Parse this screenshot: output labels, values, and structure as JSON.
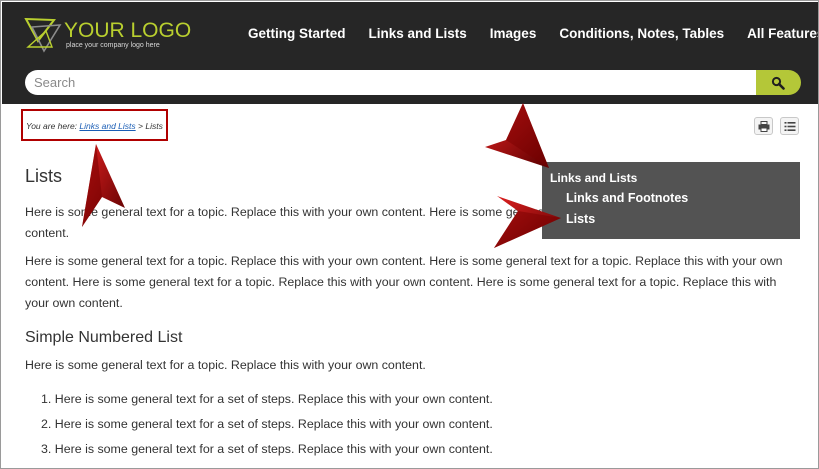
{
  "logo": {
    "text": "YOUR LOGO",
    "tagline": "place your company logo here"
  },
  "topnav": {
    "items": [
      "Getting Started",
      "Links and Lists",
      "Images",
      "Conditions, Notes, Tables",
      "All Features"
    ]
  },
  "search": {
    "placeholder": "Search"
  },
  "breadcrumb": {
    "prefix": "You are here:",
    "link": "Links and Lists",
    "separator": ">",
    "current": "Lists"
  },
  "toolbar": {
    "print_icon": "printer-icon",
    "toc_icon": "list-icon"
  },
  "sidemenu": {
    "parent": "Links and Lists",
    "children": [
      "Links and Footnotes",
      "Lists"
    ]
  },
  "content": {
    "title": "Lists",
    "para1": "Here is some general text for a topic. Replace this with your own content. Here is some general text for a topic. Replace this with your own content.",
    "para2": "Here is some general text for a topic. Replace this with your own content. Here is some general text for a topic. Replace this with your own content. Here is some general text for a topic. Replace this with your own content. Here is some general text for a topic. Replace this with your own content.",
    "section_title": "Simple Numbered List",
    "section_para": "Here is some general text for a topic. Replace this with your own content.",
    "steps": [
      "1. Here is some general text for a set of steps. Replace this with your own content.",
      "2. Here is some general text for a set of steps. Replace this with your own content.",
      "3. Here is some general text for a set of steps. Replace this with your own content."
    ]
  },
  "colors": {
    "header": "#262626",
    "accent": "#b4c738",
    "menu_panel": "#535353",
    "callout": "#b00000"
  }
}
